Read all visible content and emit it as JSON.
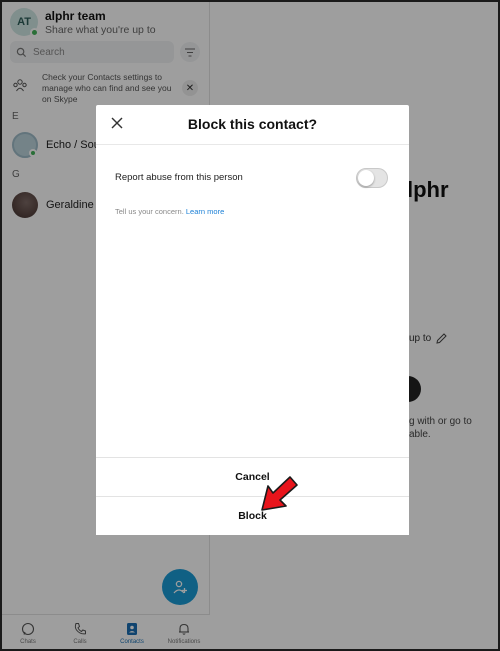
{
  "profile": {
    "initials": "AT",
    "name": "alphr team",
    "status": "Share what you're up to"
  },
  "search": {
    "placeholder": "Search"
  },
  "notice": {
    "text": "Check your Contacts settings to manage who can find and see you on Skype"
  },
  "sections": [
    {
      "letter": "E",
      "contact": "Echo / Sou"
    },
    {
      "letter": "G",
      "contact": "Geraldine A"
    }
  ],
  "nav": [
    {
      "label": "Chats",
      "icon": "chat-icon"
    },
    {
      "label": "Calls",
      "icon": "phone-icon"
    },
    {
      "label": "Contacts",
      "icon": "contacts-icon"
    },
    {
      "label": "Notifications",
      "icon": "bell-icon"
    }
  ],
  "background": {
    "title_fragment": "lphr",
    "upto_fragment": "up to",
    "line1": "g with or go to",
    "line2": "able."
  },
  "modal": {
    "title": "Block this contact?",
    "report_label": "Report abuse from this person",
    "report_enabled": false,
    "concern_text": "Tell us your concern.",
    "learn_more": "Learn more",
    "cancel": "Cancel",
    "block": "Block"
  },
  "colors": {
    "accent": "#1a9bd6",
    "online": "#44b35a",
    "annotation_arrow": "#e8141b"
  }
}
